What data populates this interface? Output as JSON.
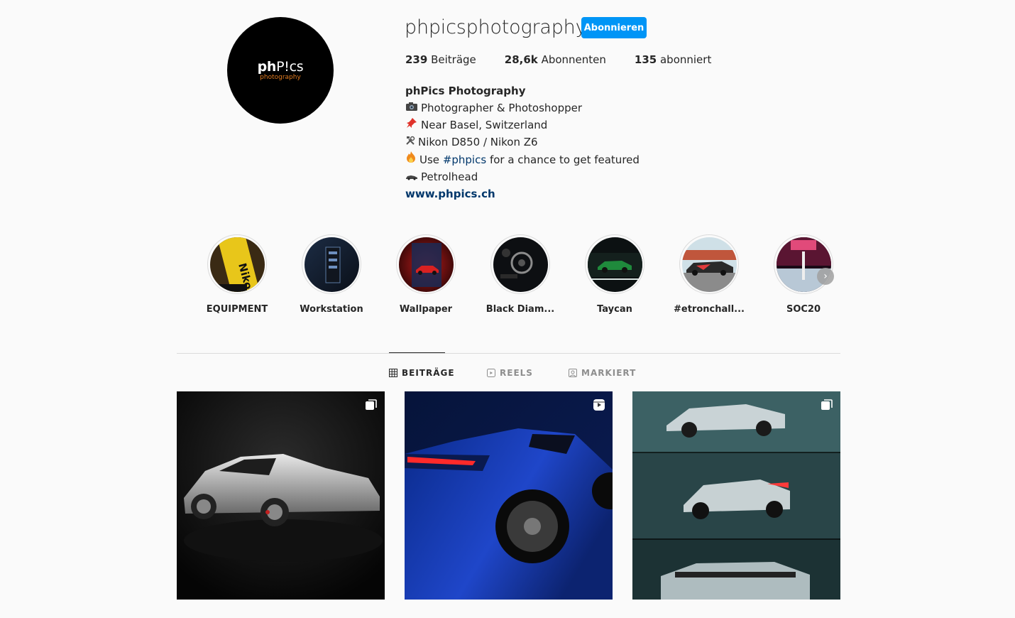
{
  "profile": {
    "username": "phpicsphotography",
    "follow_label": "Abonnieren",
    "logo_text_bold": "ph",
    "logo_text_light": "P!cs",
    "logo_subtext": "photography",
    "stats": {
      "posts_count": "239",
      "posts_label": "Beiträge",
      "followers_count": "28,6k",
      "followers_label": "Abonnenten",
      "following_count": "135",
      "following_label": "abonniert"
    },
    "bio": {
      "name": "phPics Photography",
      "line1": "Photographer & Photoshopper",
      "line2": "Near Basel, Switzerland",
      "line3": "Nikon D850 / Nikon Z6",
      "line4_pre": "Use",
      "line4_tag": "#phpics",
      "line4_post": "for a chance to get featured",
      "line5": "Petrolhead",
      "website": "www.phpics.ch"
    }
  },
  "highlights": [
    {
      "label": "EQUIPMENT"
    },
    {
      "label": "Workstation"
    },
    {
      "label": "Wallpaper"
    },
    {
      "label": "Black Diam..."
    },
    {
      "label": "Taycan"
    },
    {
      "label": "#etronchall..."
    },
    {
      "label": "SOC20"
    }
  ],
  "tabs": {
    "posts": "BEITRÄGE",
    "reels": "REELS",
    "tagged": "MARKIERT"
  },
  "icons": {
    "camera": "camera-icon",
    "pin": "pushpin-icon",
    "tools": "tools-icon",
    "fire": "fire-icon",
    "car": "car-icon"
  },
  "colors": {
    "accent": "#0095f6",
    "link": "#00376b",
    "background": "#fafafa"
  }
}
